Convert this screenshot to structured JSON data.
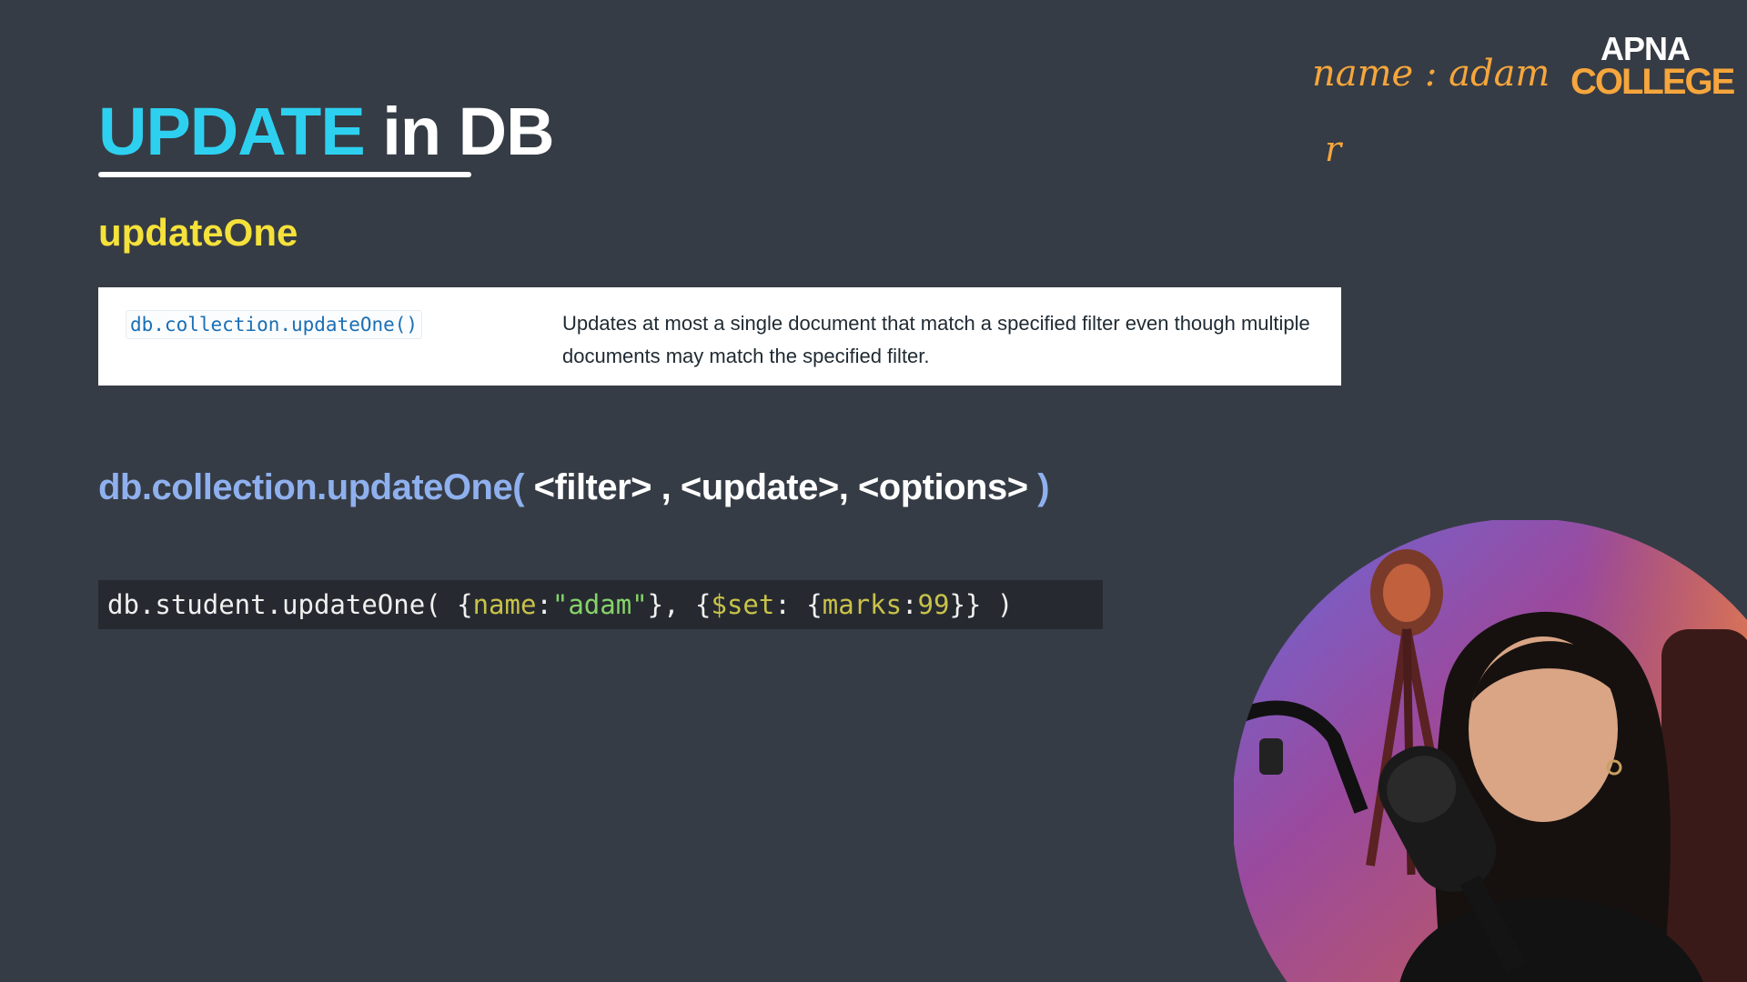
{
  "title": {
    "accent": "UPDATE",
    "rest": " in DB"
  },
  "subheading": "updateOne",
  "reference": {
    "method": "db.collection.updateOne()",
    "description": "Updates at most a single document that match a specified filter even though multiple documents may match the specified filter."
  },
  "syntax": {
    "call": "db.collection.updateOne(",
    "args": " <filter> , <update>, <options> ",
    "close": ")"
  },
  "example": {
    "prefix": "db.student.updateOne( {",
    "key1": "name",
    "colon1": ":",
    "value1": "\"adam\"",
    "mid": "}, {",
    "key2": "$set",
    "mid2": ": {",
    "key3": "marks",
    "colon2": ":",
    "value3": "99",
    "suffix": "}} )"
  },
  "notes": {
    "line1": "name : adam",
    "line2": "r"
  },
  "logo": {
    "top": "APNA",
    "bottom": "COLLEGE"
  },
  "colors": {
    "background": "#363c45",
    "title_accent": "#2ed0f0",
    "subheading": "#f5e23a",
    "syntax_blue": "#8fb0ee",
    "note_orange": "#f6a63c"
  }
}
